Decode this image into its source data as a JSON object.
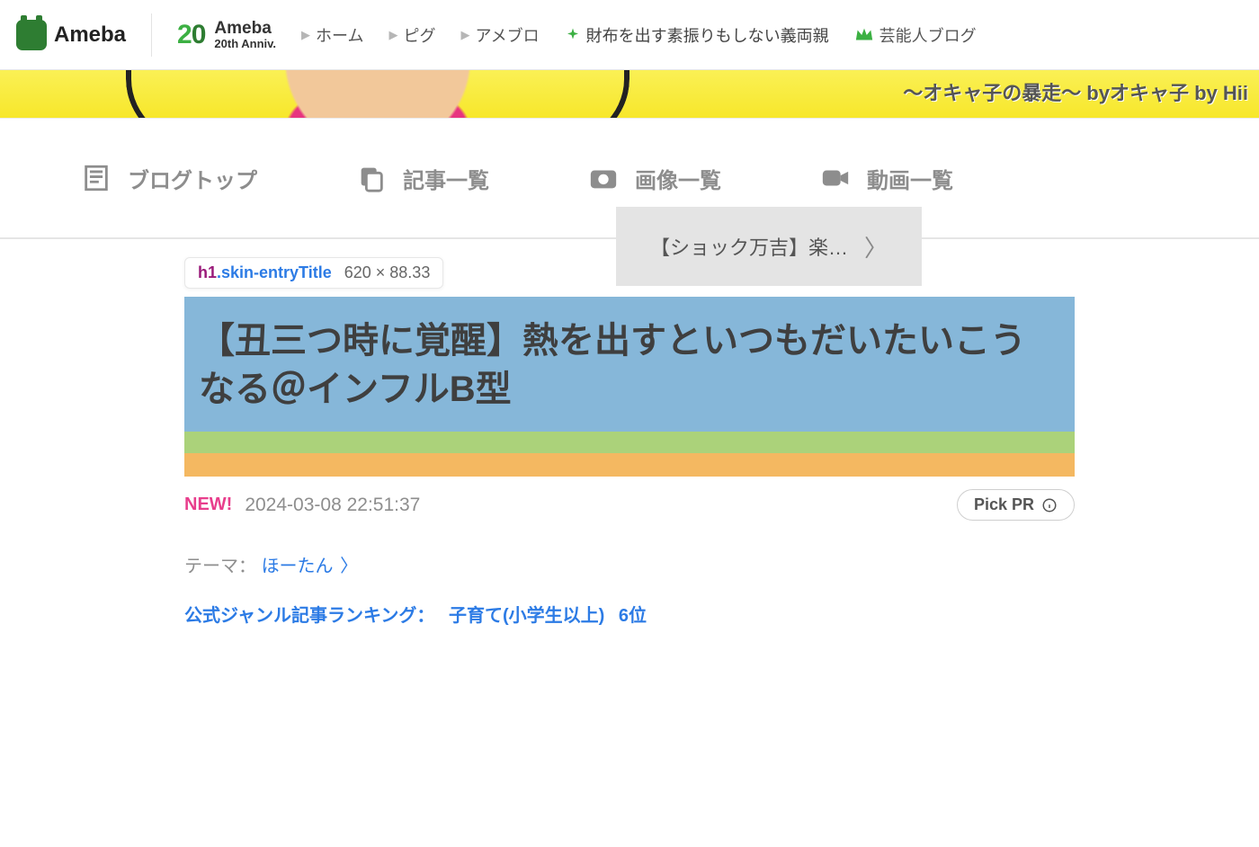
{
  "brand": {
    "name": "Ameba"
  },
  "anniv": {
    "num2": "2",
    "num0": "0",
    "line1": "Ameba",
    "line2": "20th Anniv."
  },
  "topnav": {
    "home": "ホーム",
    "pig": "ピグ",
    "ameblo": "アメブロ",
    "promo": "財布を出す素振りもしない義両親",
    "celeb": "芸能人ブログ"
  },
  "banner": {
    "tagline": "〜オキャ子の暴走〜 byオキャ子 by Hii"
  },
  "tabs": {
    "top": "ブログトップ",
    "list": "記事一覧",
    "images": "画像一覧",
    "videos": "動画一覧"
  },
  "nextPost": "【ショック万吉】楽…",
  "devtool": {
    "tag": "h1",
    "cls": ".skin-entryTitle",
    "dim": "620 × 88.33"
  },
  "entry": {
    "title": "【丑三つ時に覚醒】熱を出すといつもだいたいこうなる＠インフルB型",
    "newLabel": "NEW!",
    "datetime": "2024-03-08 22:51:37",
    "pickpr": "Pick PR"
  },
  "theme": {
    "label": "テーマ：",
    "name": "ほーたん"
  },
  "ranking": {
    "label": "公式ジャンル記事ランキング：",
    "category": "子育て(小学生以上)",
    "position": "6位"
  }
}
